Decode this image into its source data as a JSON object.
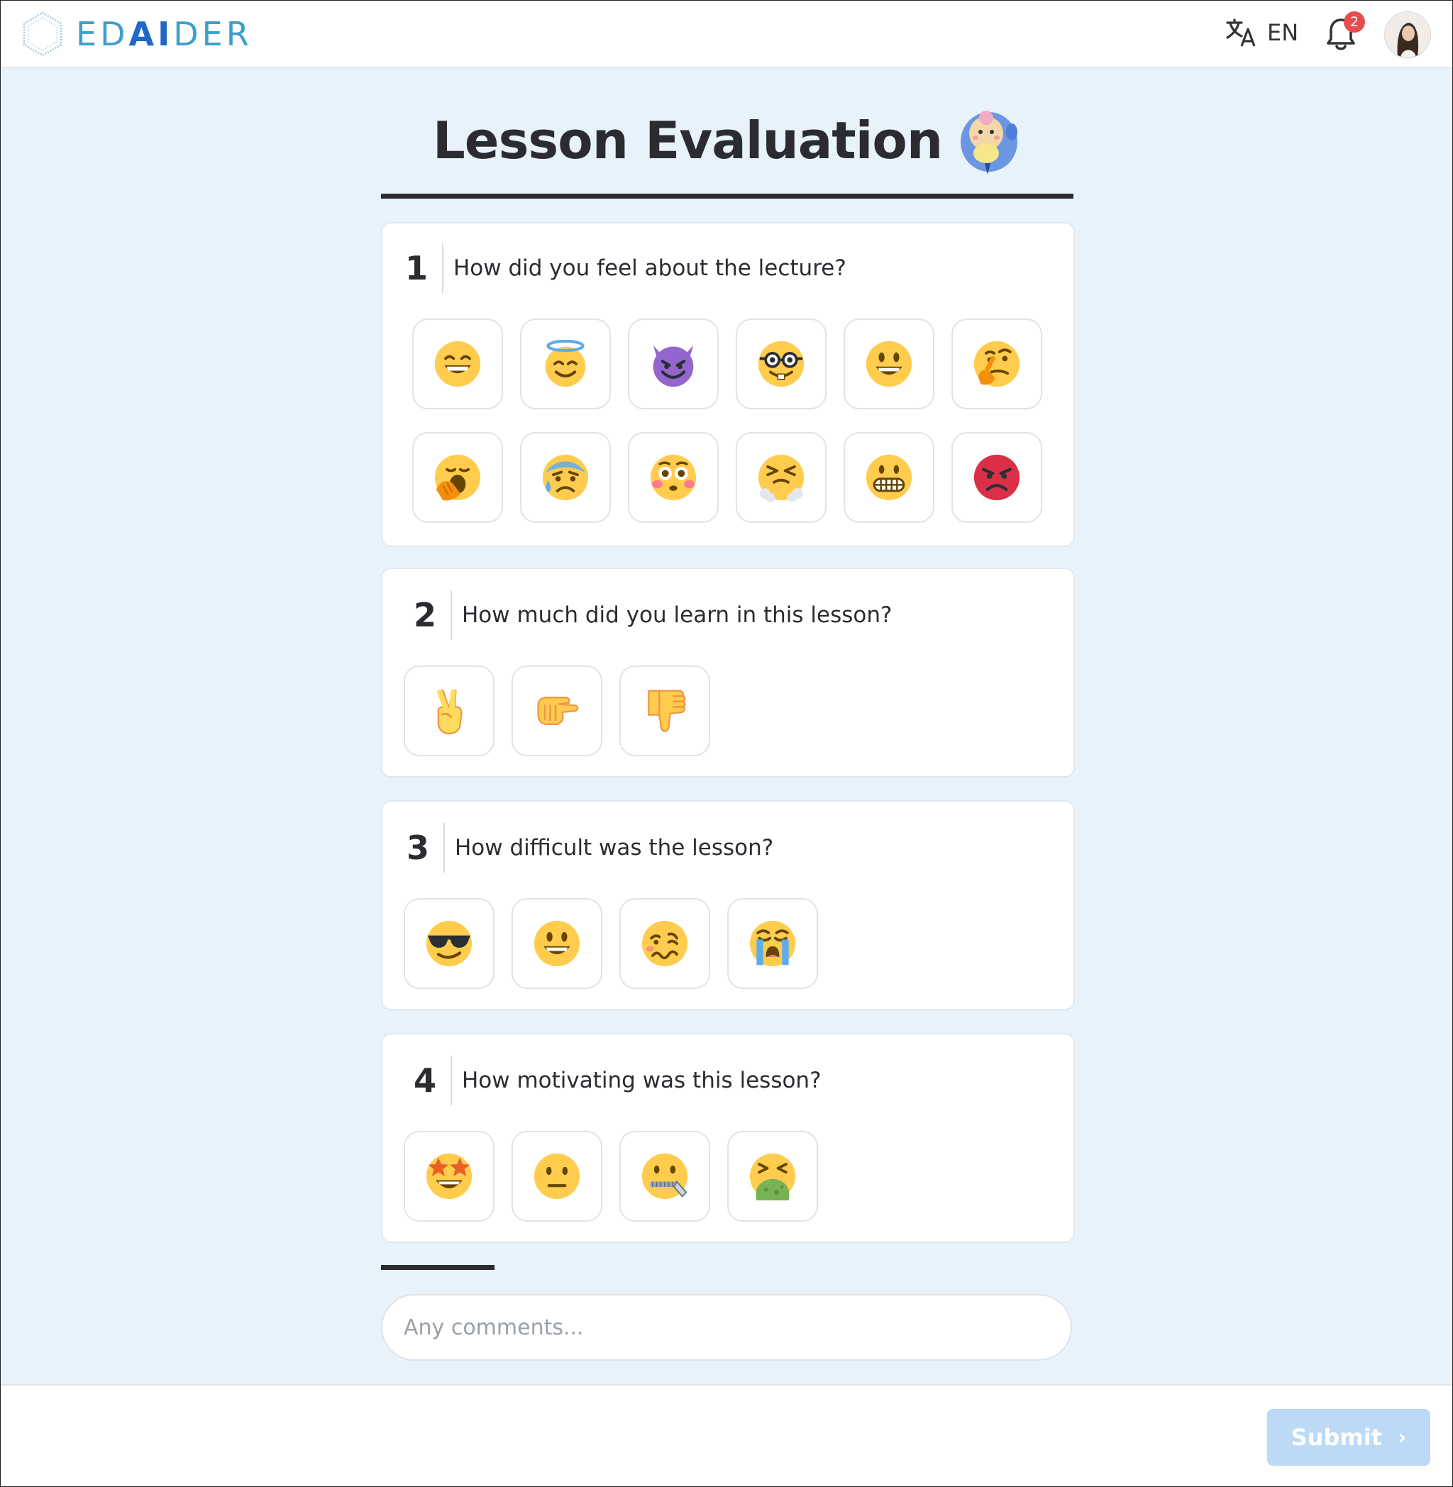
{
  "header": {
    "logo_text_left": "ED",
    "logo_text_ai": "AI",
    "logo_text_right": "DER",
    "language": "EN",
    "notification_count": "2"
  },
  "page": {
    "title": "Lesson Evaluation"
  },
  "questions": [
    {
      "number": "1",
      "text": "How did you feel about the lecture?",
      "options": [
        "grinning-face",
        "smiling-face-with-halo",
        "smiling-face-with-horns",
        "nerd-face",
        "grinning-face-big-eyes",
        "thinking-face",
        "yawning-face",
        "anxious-face-with-sweat",
        "flushed-face",
        "face-with-steam",
        "grimacing-face",
        "pouting-face"
      ]
    },
    {
      "number": "2",
      "text": "How much did you learn in this lesson?",
      "options": [
        "victory-hand",
        "pinching-hand",
        "thumbs-down"
      ]
    },
    {
      "number": "3",
      "text": "How difficult was the lesson?",
      "options": [
        "smiling-face-with-sunglasses",
        "grinning-face-big-eyes",
        "woozy-face",
        "loudly-crying-face"
      ]
    },
    {
      "number": "4",
      "text": "How motivating was this lesson?",
      "options": [
        "star-struck",
        "neutral-face",
        "zipper-mouth-face",
        "face-vomiting"
      ]
    }
  ],
  "comments": {
    "placeholder": "Any comments..."
  },
  "footer": {
    "submit_label": "Submit"
  },
  "colors": {
    "background": "#e8f2fb",
    "accent": "#2166c9",
    "logo": "#3e9fcb",
    "submit_disabled": "#bcd9f6",
    "emoji_yellow": "#ffcc4d",
    "badge": "#e74d4d"
  }
}
